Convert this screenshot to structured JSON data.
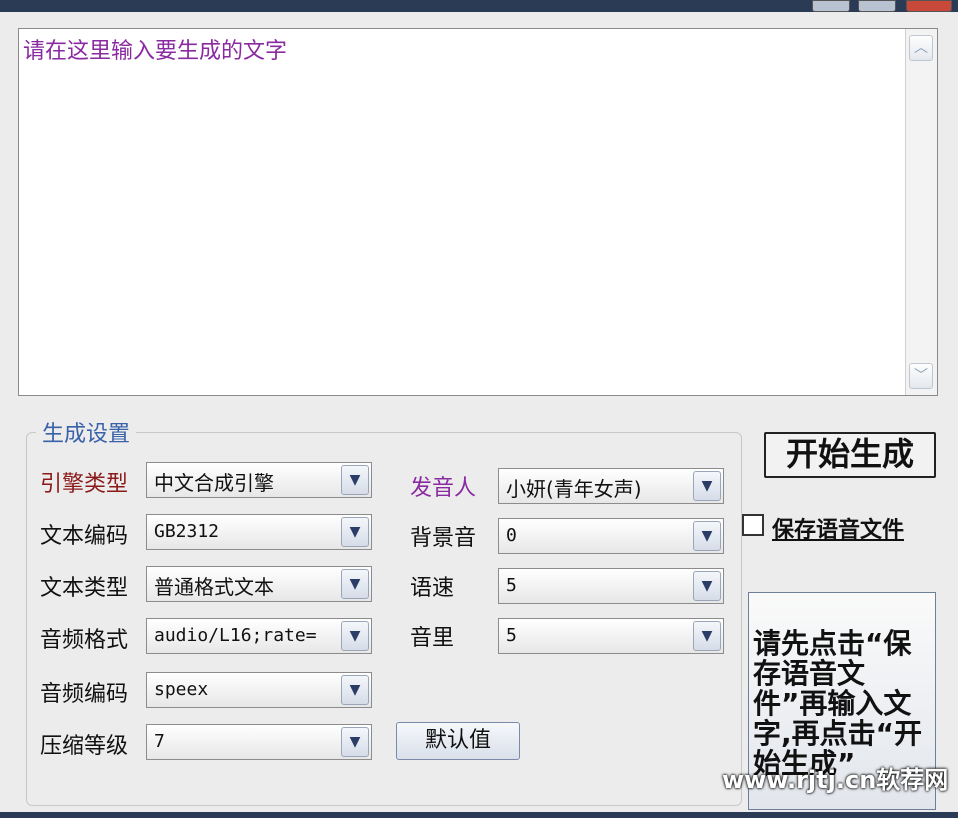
{
  "input": {
    "placeholder": "请在这里输入要生成的文字"
  },
  "settings": {
    "group_title": "生成设置",
    "left": [
      {
        "label": "引擎类型",
        "value": "中文合成引擎"
      },
      {
        "label": "文本编码",
        "value": "GB2312"
      },
      {
        "label": "文本类型",
        "value": "普通格式文本"
      },
      {
        "label": "音频格式",
        "value": "audio/L16;rate="
      },
      {
        "label": "音频编码",
        "value": "speex"
      },
      {
        "label": "压缩等级",
        "value": "7"
      }
    ],
    "right": [
      {
        "label": "发音人",
        "value": "小妍(青年女声)"
      },
      {
        "label": "背景音",
        "value": "0"
      },
      {
        "label": "语速",
        "value": "5"
      },
      {
        "label": "音里",
        "value": "5"
      }
    ],
    "default_button": "默认值"
  },
  "actions": {
    "start_button": "开始生成",
    "save_checkbox_label": "保存语音文件",
    "save_checked": false,
    "hint": "请先点击“保存语音文件”再输入文字,再点击“开始生成”"
  },
  "icons": {
    "dropdown": "chevron-down-icon",
    "scroll_up": "chevron-up-icon",
    "scroll_down": "chevron-down-icon"
  },
  "watermark": "www.rjtj.cn软荐网"
}
